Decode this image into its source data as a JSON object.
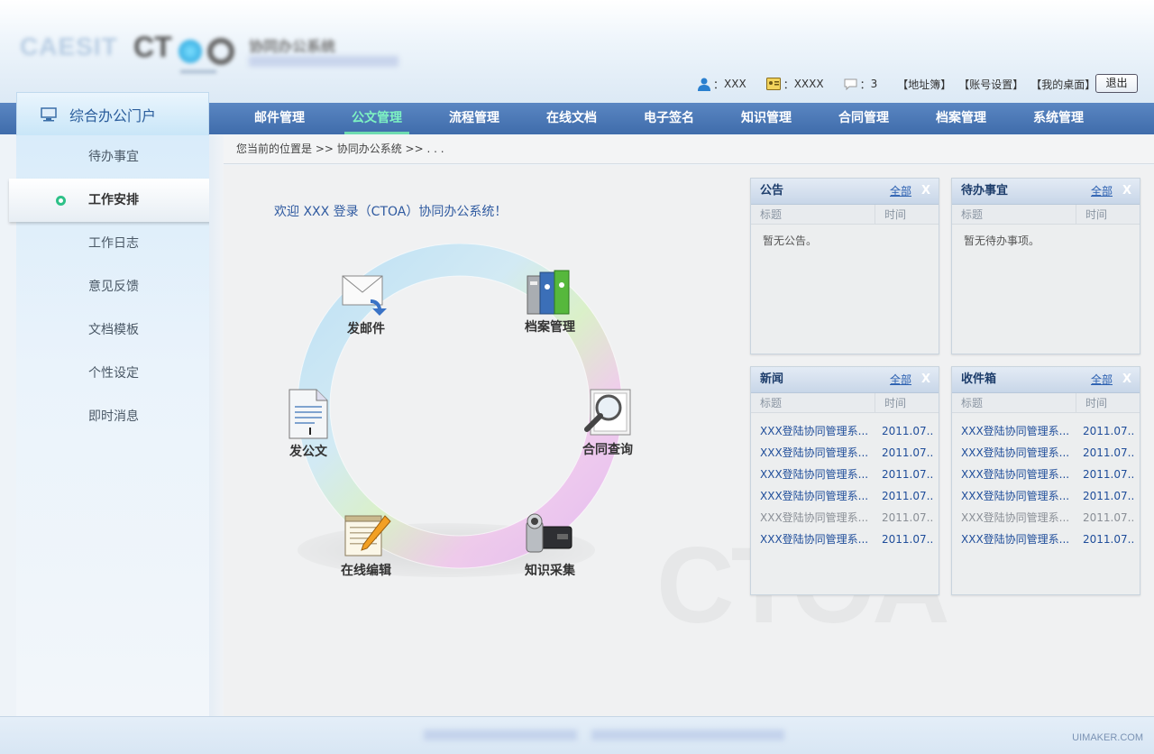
{
  "header": {
    "logo_left": "CAESIT",
    "logo_main": "CT",
    "logo_cn": "协同办公系统",
    "user_name": "XXX",
    "user_id": "XXXX",
    "message_count": "3",
    "links": [
      "【地址簿】",
      "【账号设置】",
      "【我的桌面】"
    ],
    "logout_label": "退出"
  },
  "nav": {
    "portal_label": "综合办公门户",
    "items": [
      "邮件管理",
      "公文管理",
      "流程管理",
      "在线文档",
      "电子签名",
      "知识管理",
      "合同管理",
      "档案管理",
      "系统管理"
    ],
    "active_index": 1
  },
  "sidebar": {
    "items": [
      "待办事宜",
      "工作安排",
      "工作日志",
      "意见反馈",
      "文档模板",
      "个性设定",
      "即时消息"
    ],
    "active_index": 1
  },
  "breadcrumb": "您当前的位置是 >> 协同办公系统 >> . . .",
  "welcome": "欢迎 XXX 登录（CTOA）协同办公系统！",
  "ring": {
    "items": [
      {
        "label": "发邮件",
        "icon": "mail-icon"
      },
      {
        "label": "档案管理",
        "icon": "archive-binders-icon"
      },
      {
        "label": "发公文",
        "icon": "document-icon"
      },
      {
        "label": "合同查询",
        "icon": "magnifier-icon"
      },
      {
        "label": "在线编辑",
        "icon": "notepad-pencil-icon"
      },
      {
        "label": "知识采集",
        "icon": "camcorder-icon"
      }
    ]
  },
  "panels": {
    "announcement": {
      "title": "公告",
      "all_label": "全部",
      "close": "X",
      "col_title": "标题",
      "col_time": "时间",
      "empty": "暂无公告。"
    },
    "todo": {
      "title": "待办事宜",
      "all_label": "全部",
      "close": "X",
      "col_title": "标题",
      "col_time": "时间",
      "empty": "暂无待办事项。"
    },
    "news": {
      "title": "新闻",
      "all_label": "全部",
      "close": "X",
      "col_title": "标题",
      "col_time": "时间",
      "rows": [
        {
          "title": "XXX登陆协同管理系...",
          "date": "2011.07..",
          "read": false
        },
        {
          "title": "XXX登陆协同管理系...",
          "date": "2011.07..",
          "read": false
        },
        {
          "title": "XXX登陆协同管理系...",
          "date": "2011.07..",
          "read": false
        },
        {
          "title": "XXX登陆协同管理系...",
          "date": "2011.07..",
          "read": false
        },
        {
          "title": "XXX登陆协同管理系...",
          "date": "2011.07..",
          "read": true
        },
        {
          "title": "XXX登陆协同管理系...",
          "date": "2011.07..",
          "read": false
        }
      ]
    },
    "inbox": {
      "title": "收件箱",
      "all_label": "全部",
      "close": "X",
      "col_title": "标题",
      "col_time": "时间",
      "rows": [
        {
          "title": "XXX登陆协同管理系...",
          "date": "2011.07..",
          "read": false
        },
        {
          "title": "XXX登陆协同管理系...",
          "date": "2011.07..",
          "read": false
        },
        {
          "title": "XXX登陆协同管理系...",
          "date": "2011.07..",
          "read": false
        },
        {
          "title": "XXX登陆协同管理系...",
          "date": "2011.07..",
          "read": false
        },
        {
          "title": "XXX登陆协同管理系...",
          "date": "2011.07..",
          "read": true
        },
        {
          "title": "XXX登陆协同管理系...",
          "date": "2011.07..",
          "read": false
        }
      ]
    }
  },
  "footer": {
    "mark": "UIMAKER.COM"
  },
  "colors": {
    "nav_bg": "#4a78b8",
    "nav_active": "#7ef3c2",
    "link_blue": "#1f4d9a"
  }
}
